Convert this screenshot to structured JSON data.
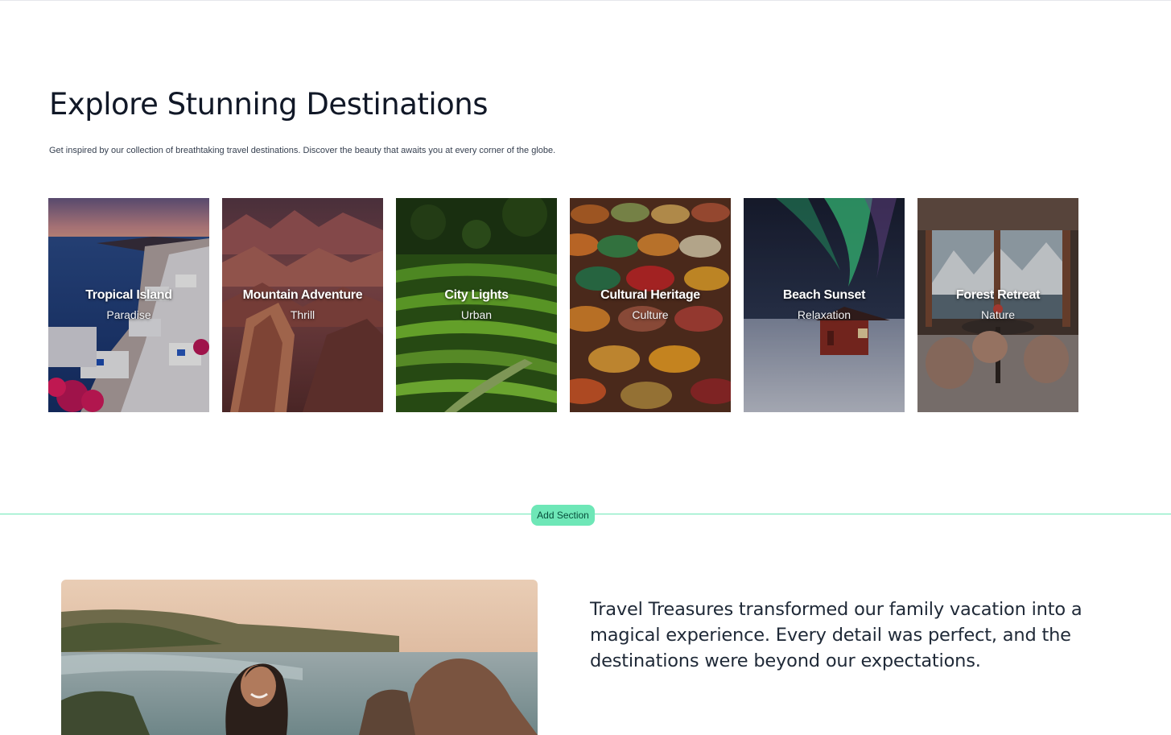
{
  "hero": {
    "title": "Explore Stunning Destinations",
    "subtitle": "Get inspired by our collection of breathtaking travel destinations. Discover the beauty that awaits you at every corner of the globe."
  },
  "destinations": [
    {
      "title": "Tropical Island",
      "tag": "Paradise"
    },
    {
      "title": "Mountain Adventure",
      "tag": "Thrill"
    },
    {
      "title": "City Lights",
      "tag": "Urban"
    },
    {
      "title": "Cultural Heritage",
      "tag": "Culture"
    },
    {
      "title": "Beach Sunset",
      "tag": "Relaxation"
    },
    {
      "title": "Forest Retreat",
      "tag": "Nature"
    }
  ],
  "editor": {
    "add_section_label": "Add Section"
  },
  "testimonial": {
    "quote": "Travel Treasures transformed our family vacation into a magical experience. Every detail was perfect, and the destinations were beyond our expectations."
  },
  "colors": {
    "accent": "#6ee7b7",
    "heading": "#111827",
    "body": "#1f2937"
  }
}
